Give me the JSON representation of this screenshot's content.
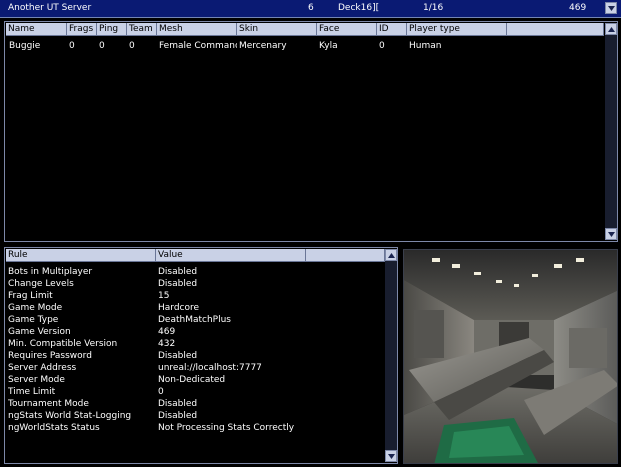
{
  "server": {
    "name": "Another UT Server",
    "ping": "6",
    "map": "Deck16][",
    "players": "1/16",
    "version": "469",
    "menu_icon": "dropdown-arrow-icon"
  },
  "players_table": {
    "columns": [
      "Name",
      "Frags",
      "Ping",
      "Team",
      "Mesh",
      "Skin",
      "Face",
      "ID",
      "Player type"
    ],
    "rows": [
      [
        "Buggie",
        "0",
        "0",
        "0",
        "Female Commanc",
        "Mercenary",
        "Kyla",
        "0",
        "Human"
      ]
    ]
  },
  "rules_table": {
    "columns": [
      "Rule",
      "Value"
    ],
    "rows": [
      [
        "Bots in Multiplayer",
        "Disabled"
      ],
      [
        "Change Levels",
        "Disabled"
      ],
      [
        "Frag Limit",
        "15"
      ],
      [
        "Game Mode",
        "Hardcore"
      ],
      [
        "Game Type",
        "DeathMatchPlus"
      ],
      [
        "Game Version",
        "469"
      ],
      [
        "Min. Compatible Version",
        "432"
      ],
      [
        "Requires Password",
        "Disabled"
      ],
      [
        "Server Address",
        "unreal://localhost:7777"
      ],
      [
        "Server Mode",
        "Non-Dedicated"
      ],
      [
        "Time Limit",
        "0"
      ],
      [
        "Tournament Mode",
        "Disabled"
      ],
      [
        "ngStats World Stat-Logging",
        "Disabled"
      ],
      [
        "ngWorldStats Status",
        "Not Processing Stats Correctly"
      ]
    ]
  },
  "colors": {
    "server_bar": "#0a1a73",
    "header_bg": "#c9d1e6",
    "panel_border": "#7d88a8"
  }
}
